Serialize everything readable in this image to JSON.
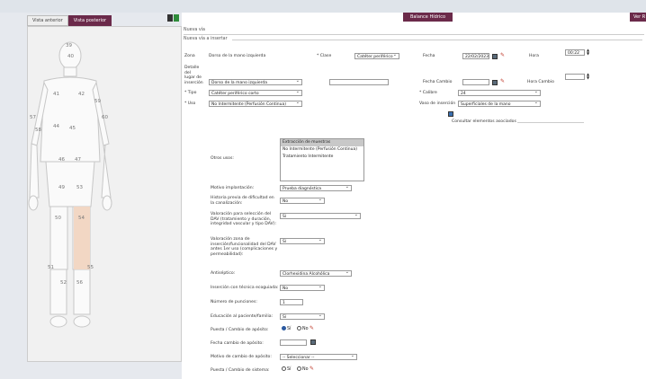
{
  "tabs": [
    {
      "label": "Vista anterior",
      "active": false
    },
    {
      "label": "Vista posterior",
      "active": true
    }
  ],
  "header": {
    "balance": "Balance Hídrico",
    "ver": "Ver R"
  },
  "breadcrumb": {
    "line1": "Nueva vía",
    "line2": "Nueva vía a insertar"
  },
  "body_numbers": [
    "39",
    "40",
    "41",
    "42",
    "43",
    "44",
    "45",
    "46",
    "47",
    "48",
    "49",
    "50",
    "51",
    "52",
    "53",
    "54",
    "55",
    "56",
    "57",
    "58",
    "59",
    "60",
    "61",
    "62"
  ],
  "form": {
    "zona_label": "Zona",
    "zona_value": "Dorso de la mano izquierda",
    "clase_label": "* Clase",
    "clase_value": "Catéter periférico",
    "fecha_label": "Fecha",
    "fecha_value": "22/02/2023",
    "hora_label": "Hora",
    "hora_value": "00:22",
    "detalle_label": "Detalle del lugar de inserción",
    "detalle_value": "Dorso de la mano izquierda",
    "fecha_cambio_label": "Fecha Cambio",
    "hora_cambio_label": "Hora Cambio",
    "tipo_label": "* Tipo",
    "tipo_value": "Catéter periférico corto",
    "calibre_label": "* Calibre",
    "calibre_value": "24",
    "uso_label": "* Uso",
    "uso_value": "No Intermitente (Perfusión Continua)",
    "vaso_label": "Vaso de inserción",
    "vaso_value": "Superficiales de la mano",
    "consultar": "Consultar elementos asociados",
    "otros_usos_label": "Otros usos:",
    "otros_usos_options": [
      "Extracción de muestras",
      "No Intermitente (Perfusión Continua)",
      "Tratamiento Intermitente"
    ],
    "motivo_label": "Motivo implantación:",
    "motivo_value": "Prueba diagnóstica",
    "historia_label": "Historia previa de dificultad en la canalización:",
    "historia_value": "No",
    "valoracion_label": "Valoración para selección del DAV (tratamiento y duración, integridad vascular y tipo DAV):",
    "valoracion_value": "Sí",
    "valoracion_zona_label": "Valoración zona de inserción/funcionalidad del DAV antes 1er uso (complicaciones y permeabilidad):",
    "valoracion_zona_value": "Sí",
    "antiseptico_label": "Antiséptico:",
    "antiseptico_value": "Clorhexidina Alcohólica",
    "insercion_label": "Inserción con técnica ecoguiada:",
    "insercion_value": "No",
    "punciones_label": "Número de punciones:",
    "punciones_value": "1",
    "educacion_label": "Educación al paciente/familia:",
    "educacion_value": "Sí",
    "puesta_label": "Puesta / Cambio de apósito:",
    "fecha_cambio_aposito_label": "Fecha cambio de apósito:",
    "motivo_cambio_label": "Motivo de cambio de apósito:",
    "motivo_cambio_value": "-- Seleccionar --",
    "puesta_sistema_label": "Puesta / Cambio de sistema:",
    "si": "Sí",
    "no": "No"
  }
}
